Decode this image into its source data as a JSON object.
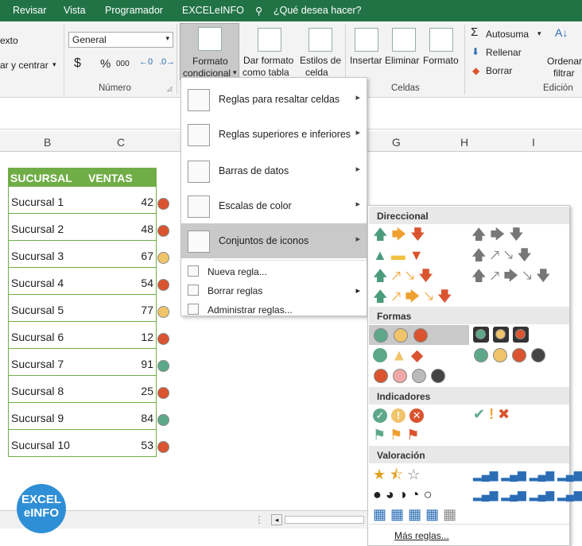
{
  "tabs": [
    "Revisar",
    "Vista",
    "Programador",
    "EXCELeINFO"
  ],
  "tellme": "¿Qué desea hacer?",
  "ribbon": {
    "align_partial": "exto",
    "merge_partial": "ar y centrar",
    "number_format": "General",
    "currency": "$",
    "percent": "%",
    "thousands": "000",
    "numero_group": "Número",
    "cf_label1": "Formato",
    "cf_label2": "condicional",
    "table_label1": "Dar formato",
    "table_label2": "como tabla",
    "styles_label1": "Estilos de",
    "styles_label2": "celda",
    "insert_label": "Insertar",
    "delete_label": "Eliminar",
    "format_label": "Formato",
    "celdas_group": "Celdas",
    "autosum": "Autosuma",
    "fill": "Rellenar",
    "clear": "Borrar",
    "sort1": "Ordenar",
    "sort2": "filtrar",
    "edicion_group": "Edición"
  },
  "columns": [
    "B",
    "C",
    "G",
    "H",
    "I"
  ],
  "table": {
    "header_branch": "SUCURSAL",
    "header_sales": "VENTAS",
    "rows": [
      {
        "name": "Sucursal 1",
        "value": "42",
        "icon": "red"
      },
      {
        "name": "Sucursal 2",
        "value": "48",
        "icon": "red"
      },
      {
        "name": "Sucursal 3",
        "value": "67",
        "icon": "yellow"
      },
      {
        "name": "Sucursal 4",
        "value": "54",
        "icon": "red"
      },
      {
        "name": "Sucursal 5",
        "value": "77",
        "icon": "yellow"
      },
      {
        "name": "Sucursal 6",
        "value": "12",
        "icon": "red"
      },
      {
        "name": "Sucursal 7",
        "value": "91",
        "icon": "green"
      },
      {
        "name": "Sucursal 8",
        "value": "25",
        "icon": "red"
      },
      {
        "name": "Sucursal 9",
        "value": "84",
        "icon": "green"
      },
      {
        "name": "Sucursal 10",
        "value": "53",
        "icon": "red"
      }
    ]
  },
  "cf_menu": {
    "items": [
      "Reglas para resaltar celdas",
      "Reglas superiores e inferiores",
      "Barras de datos",
      "Escalas de color",
      "Conjuntos de iconos"
    ],
    "new_rule": "Nueva regla...",
    "clear_rules": "Borrar reglas",
    "manage_rules": "Administrar reglas..."
  },
  "iconsets": {
    "direccional": "Direccional",
    "formas": "Formas",
    "indicadores": "Indicadores",
    "valoracion": "Valoración",
    "more_rules": "Más reglas..."
  },
  "logo": {
    "line1": "EXCEL",
    "line2": "eINFO"
  },
  "colors": {
    "green": "#5ea88a",
    "red": "#d9542f",
    "yellow": "#f0c46b",
    "excel": "#217346",
    "header": "#70ad47"
  },
  "icons": [
    "search-icon",
    "arrow-up-icon",
    "arrow-right-icon",
    "arrow-down-icon",
    "circle-icon",
    "triangle-icon",
    "diamond-icon",
    "check-icon",
    "exclamation-icon",
    "cross-icon",
    "flag-icon",
    "star-icon",
    "signal-bars-icon",
    "pie-quarter-icon",
    "box-icon"
  ]
}
